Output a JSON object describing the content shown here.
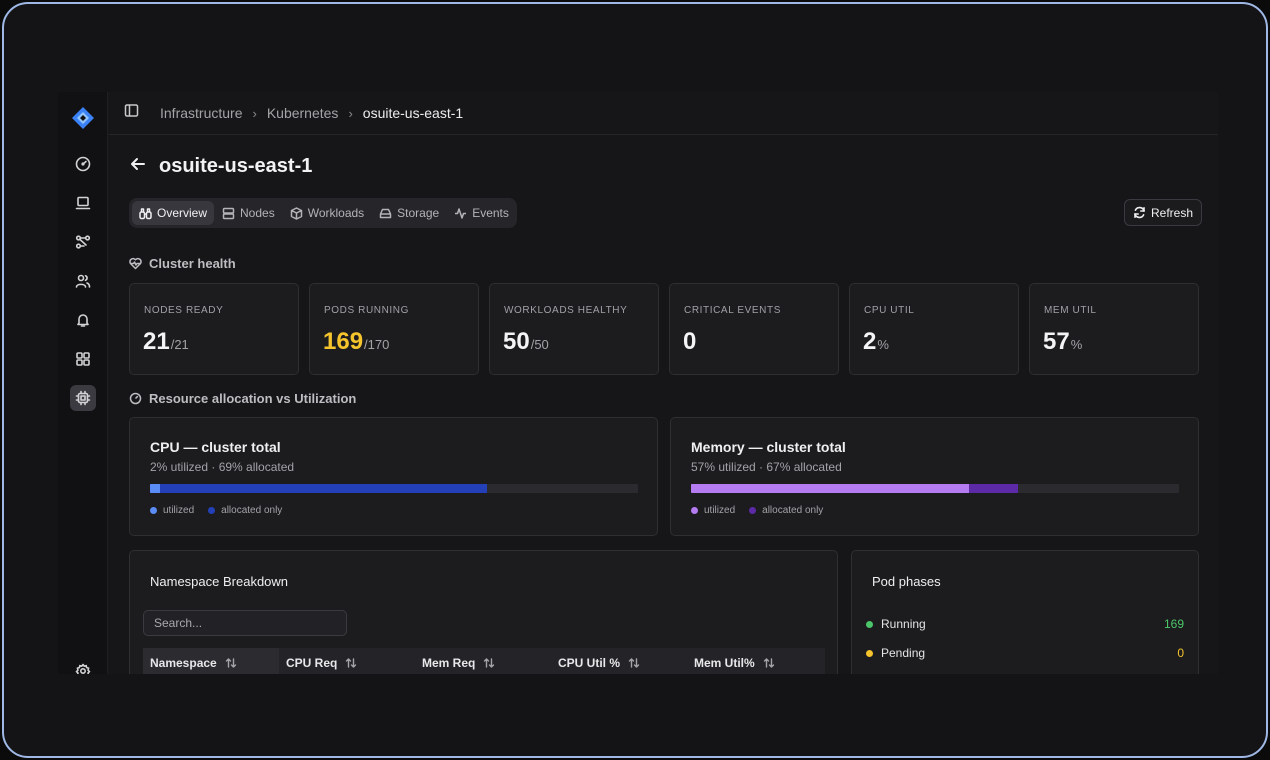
{
  "breadcrumb": [
    "Infrastructure",
    "Kubernetes",
    "osuite-us-east-1"
  ],
  "page": {
    "title": "osuite-us-east-1"
  },
  "tabs": [
    {
      "label": "Overview",
      "icon": "binoculars-icon",
      "active": true
    },
    {
      "label": "Nodes",
      "icon": "server-icon"
    },
    {
      "label": "Workloads",
      "icon": "box-icon"
    },
    {
      "label": "Storage",
      "icon": "hard-drive-icon"
    },
    {
      "label": "Events",
      "icon": "activity-icon"
    }
  ],
  "actions": {
    "refresh_label": "Refresh"
  },
  "health": {
    "heading": "Cluster health",
    "stats": [
      {
        "label": "NODES READY",
        "value": "21",
        "unit": "/21"
      },
      {
        "label": "PODS RUNNING",
        "value": "169",
        "unit": "/170",
        "warn": true
      },
      {
        "label": "WORKLOADS HEALTHY",
        "value": "50",
        "unit": "/50"
      },
      {
        "label": "CRITICAL EVENTS",
        "value": "0",
        "unit": ""
      },
      {
        "label": "CPU UTIL",
        "value": "2",
        "unit": "%"
      },
      {
        "label": "MEM UTIL",
        "value": "57",
        "unit": "%"
      }
    ]
  },
  "allocation": {
    "heading": "Resource allocation vs Utilization",
    "cpu": {
      "title": "CPU — cluster total",
      "subtitle": "2% utilized · 69% allocated",
      "utilized_pct": 2,
      "allocated_pct": 69,
      "utilized_color": "#5b8cf5",
      "allocated_color": "#2440b8",
      "legend_utilized": "utilized",
      "legend_allocated": "allocated only"
    },
    "memory": {
      "title": "Memory — cluster total",
      "subtitle": "57% utilized · 67% allocated",
      "utilized_pct": 57,
      "allocated_pct": 67,
      "utilized_color": "#b57cf2",
      "allocated_color": "#5c2aa6",
      "legend_utilized": "utilized",
      "legend_allocated": "allocated only"
    }
  },
  "namespaces": {
    "title": "Namespace Breakdown",
    "search_placeholder": "Search...",
    "columns": [
      "Namespace",
      "CPU Req",
      "Mem Req",
      "CPU Util %",
      "Mem Util%"
    ]
  },
  "pod_phases": {
    "title": "Pod phases",
    "items": [
      {
        "label": "Running",
        "count": "169",
        "color": "#4cc66a"
      },
      {
        "label": "Pending",
        "count": "0",
        "color": "#f5c32c"
      }
    ]
  },
  "colors": {
    "warn": "#f5c32c",
    "brand": "#3b82f6"
  }
}
